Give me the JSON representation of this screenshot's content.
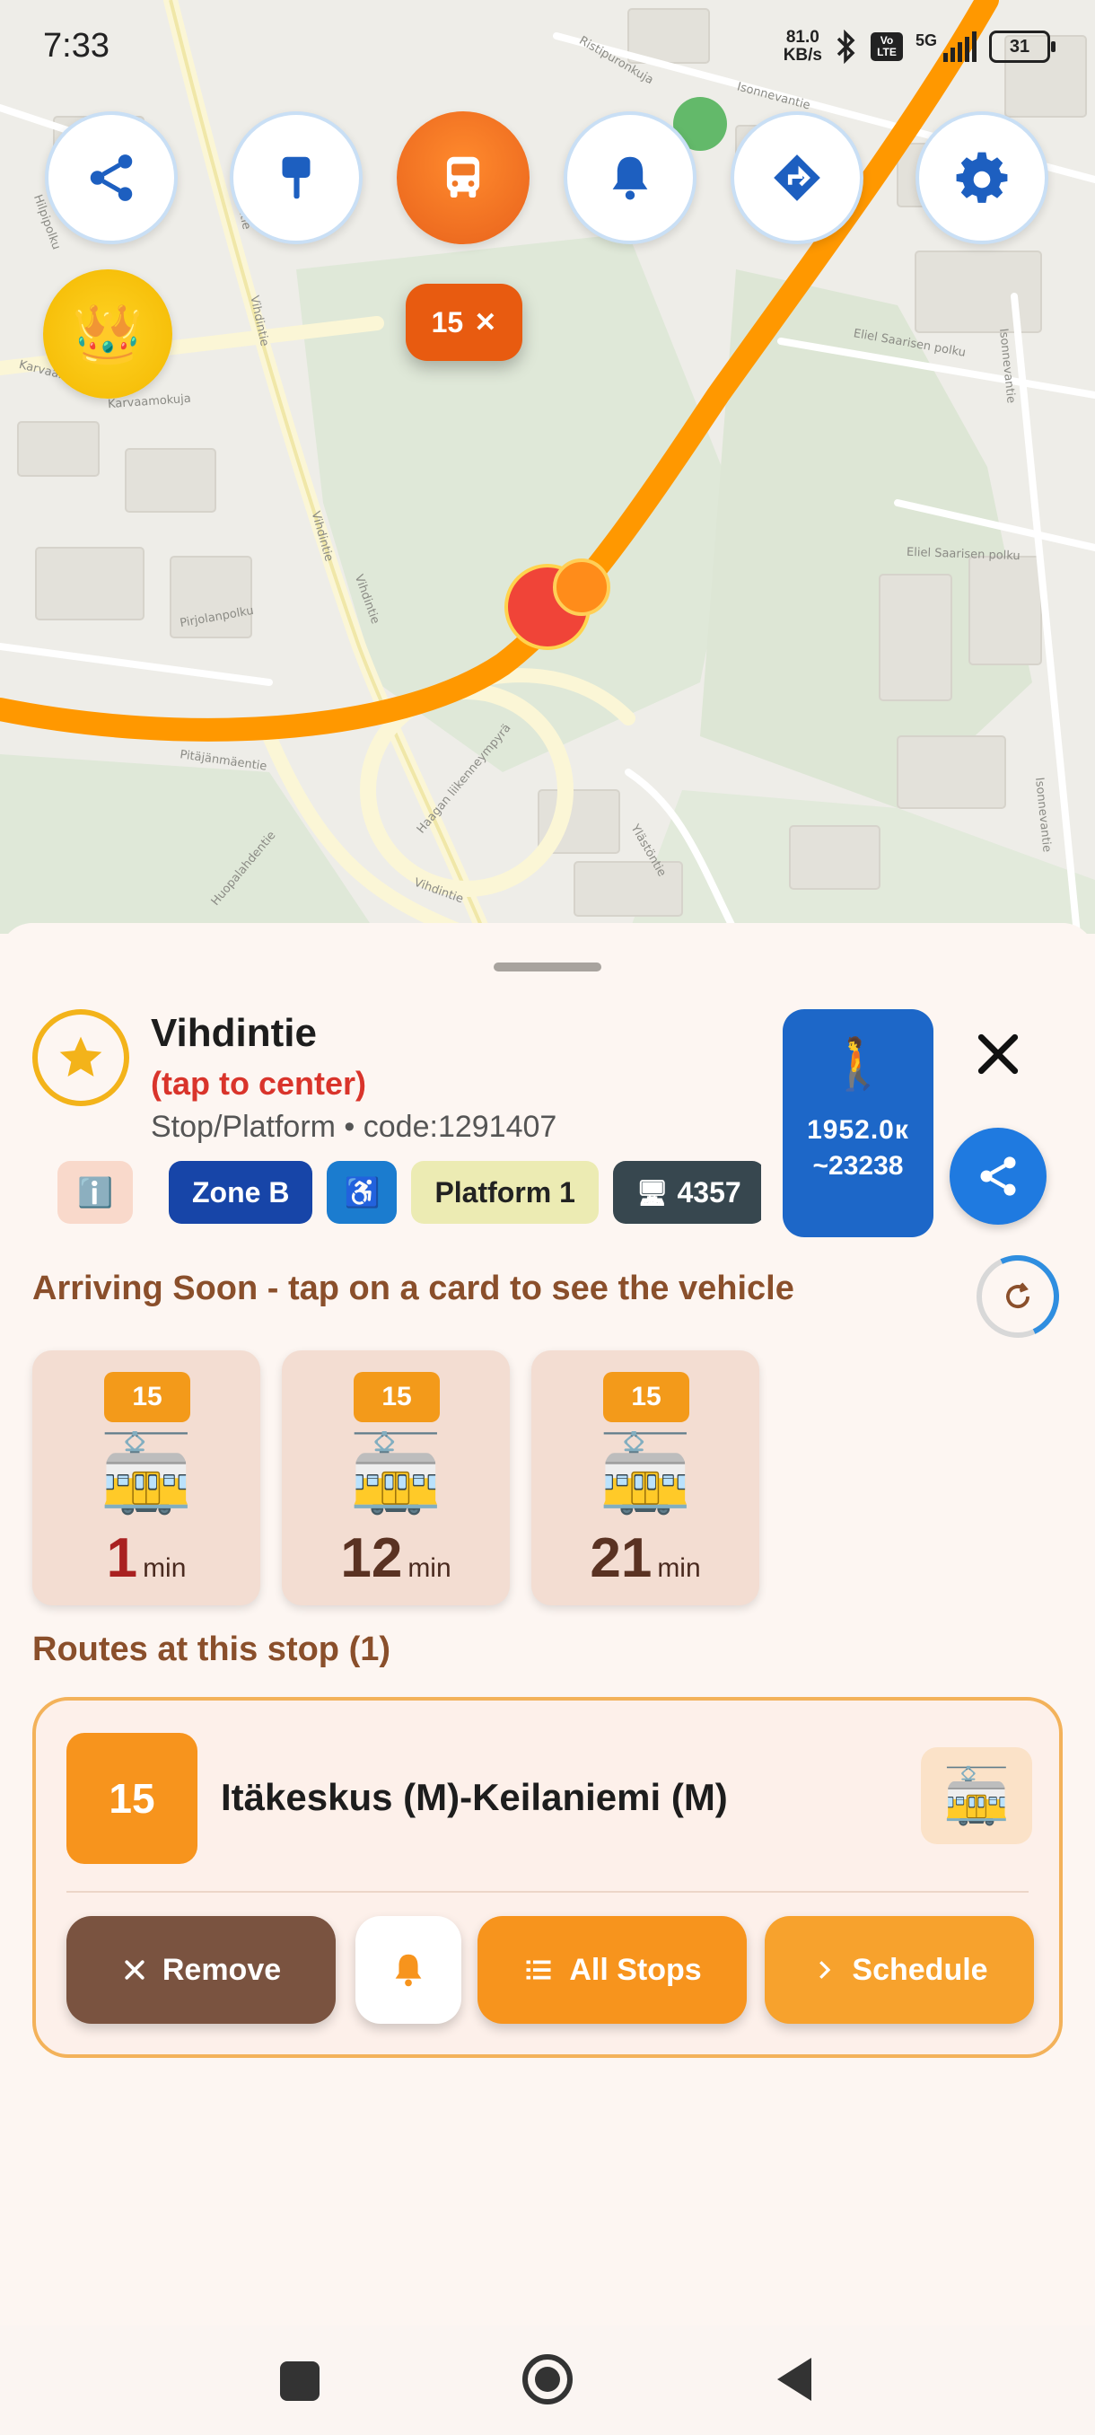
{
  "status_bar": {
    "time": "7:33",
    "net_speed_value": "81.0",
    "net_speed_unit": "KB/s",
    "volte": "Vo LTE",
    "network": "5G",
    "battery": "31"
  },
  "map": {
    "street_labels": [
      "Vihdintie",
      "Vihdintie",
      "Vihdintie",
      "Vihdintie",
      "Vihdintie",
      "Isonnevantie",
      "Isonnevantie",
      "Isonnevantie",
      "Karvaamokuja",
      "Karvaamokuja",
      "Haagan liikenneympyrä",
      "Pitäjänmäentie",
      "Huopalahdentie",
      "Eliel Saarisen polku",
      "Eliel Saarisen polku",
      "Pirjolanpolku",
      "Ristipuronkuja",
      "Hilpipolku",
      "Ylästöntie"
    ]
  },
  "top_buttons": {
    "share_icon": "share-icon",
    "stop_icon": "bus-stop-sign-icon",
    "bus_icon": "bus-icon",
    "bell_icon": "bell-icon",
    "directions_icon": "directions-icon",
    "settings_icon": "gear-icon",
    "crown_icon": "crown-icon",
    "route_chip_label": "15",
    "route_chip_close": "✕"
  },
  "stop": {
    "name": "Vihdintie",
    "tap_hint": "(tap to center)",
    "code_line": "Stop/Platform • code:1291407",
    "walk": {
      "distance": "1952.0к",
      "steps": "~23238"
    },
    "chips": {
      "info": "ℹ️",
      "zone": "Zone B",
      "accessible": "♿",
      "platform": "Platform 1",
      "display_icon": "🖥",
      "display_value": "4357"
    }
  },
  "arriving": {
    "heading": "Arriving Soon - tap on a card to see the vehicle",
    "cards": [
      {
        "route": "15",
        "minutes": "1",
        "unit": "min"
      },
      {
        "route": "15",
        "minutes": "12",
        "unit": "min"
      },
      {
        "route": "15",
        "minutes": "21",
        "unit": "min"
      }
    ]
  },
  "routes": {
    "heading": "Routes at this stop (1)",
    "items": [
      {
        "number": "15",
        "name": "Itäkeskus (M)-Keilaniemi (M)",
        "actions": {
          "remove": "Remove",
          "all_stops": "All Stops",
          "schedule": "Schedule"
        }
      }
    ]
  },
  "colors": {
    "accent_orange": "#f7941d",
    "route_line": "#ff9800",
    "primary_blue": "#1d67c8",
    "heading_brown": "#8a4f2b",
    "urgent_red": "#a92121",
    "remove_brown": "#7a5340"
  }
}
